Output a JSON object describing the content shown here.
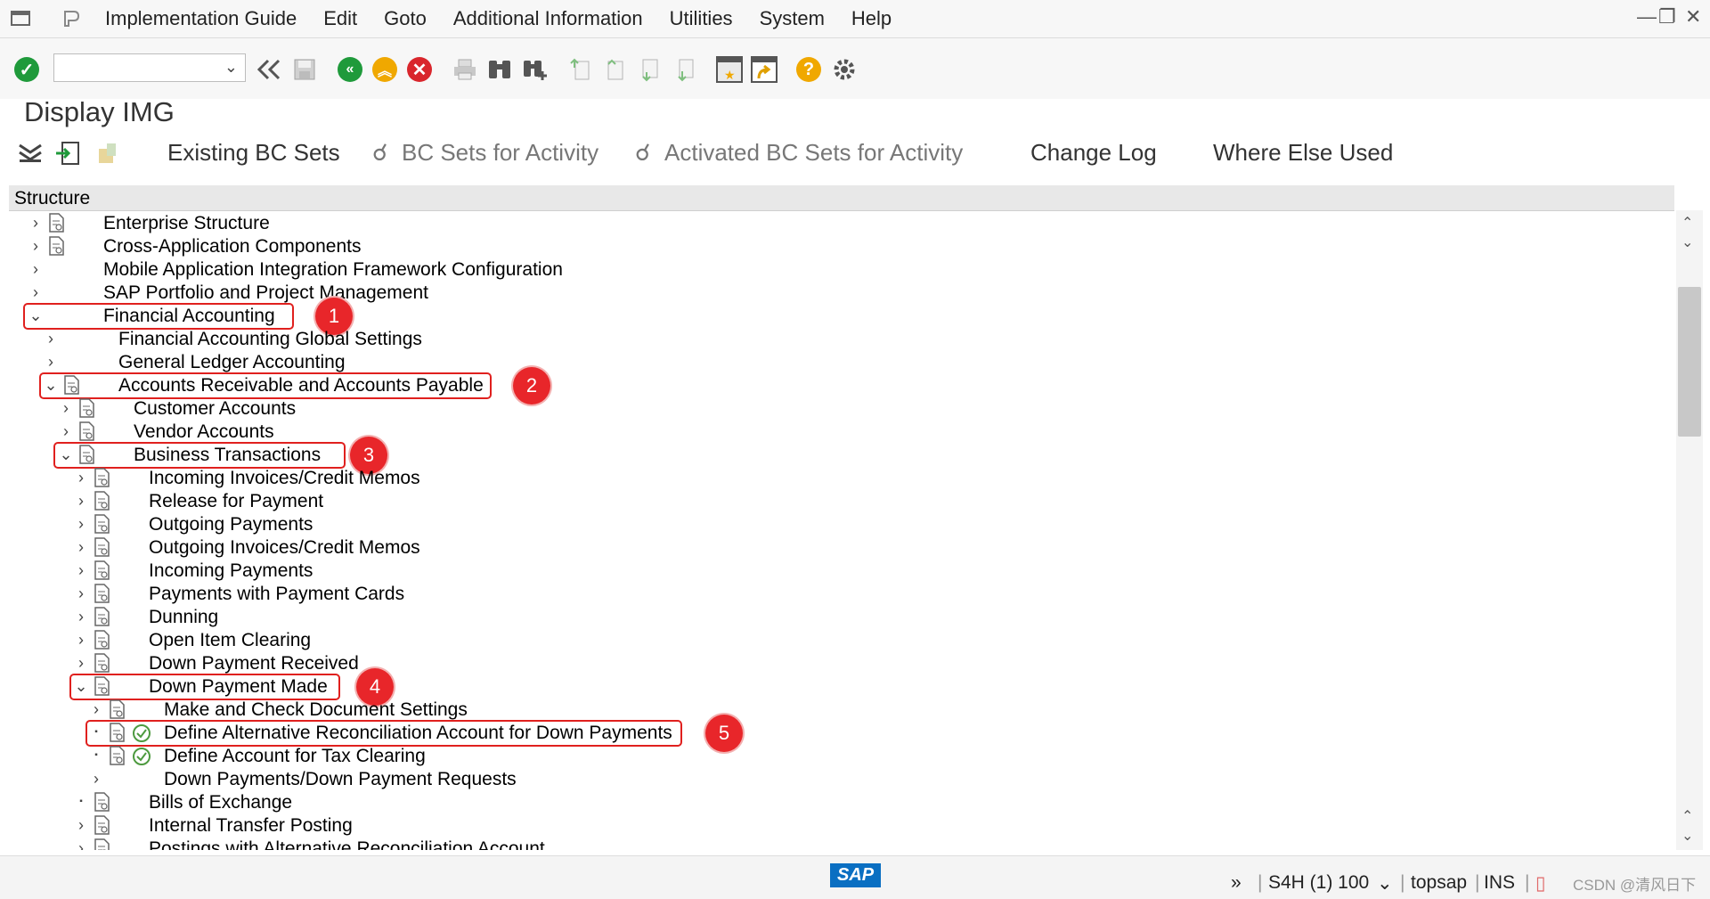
{
  "menu": {
    "items": [
      "Implementation Guide",
      "Edit",
      "Goto",
      "Additional Information",
      "Utilities",
      "System",
      "Help"
    ]
  },
  "window_controls": {
    "minimize": "—",
    "restore": "❐",
    "close": "✕"
  },
  "toolbar": {
    "command_field_value": "",
    "icons": [
      "enter-icon",
      "back-double-icon",
      "save-icon",
      "back-icon",
      "exit-icon",
      "cancel-icon",
      "print-icon",
      "find-icon",
      "find-next-icon",
      "first-page-icon",
      "previous-page-icon",
      "next-page-icon",
      "last-page-icon",
      "new-session-icon",
      "shortcut-icon",
      "help-icon",
      "settings-icon"
    ]
  },
  "page": {
    "title": "Display IMG"
  },
  "app_toolbar": {
    "existing_bc_sets": "Existing BC Sets",
    "bc_sets_for_activity": "BC Sets for Activity",
    "activated_bc_sets": "Activated BC Sets for Activity",
    "change_log": "Change Log",
    "where_else_used": "Where Else Used"
  },
  "tree": {
    "header": "Structure",
    "nodes": [
      {
        "label": "Enterprise Structure",
        "level": 0,
        "state": "collapsed",
        "doc": true
      },
      {
        "label": "Cross-Application Components",
        "level": 0,
        "state": "collapsed",
        "doc": true
      },
      {
        "label": "Mobile Application Integration Framework Configuration",
        "level": 0,
        "state": "collapsed",
        "doc": false
      },
      {
        "label": "SAP Portfolio and Project Management",
        "level": 0,
        "state": "collapsed",
        "doc": false
      },
      {
        "label": "Financial Accounting",
        "level": 0,
        "state": "expanded",
        "doc": false,
        "badge": "1"
      },
      {
        "label": "Financial Accounting Global Settings",
        "level": 1,
        "state": "collapsed",
        "doc": false
      },
      {
        "label": "General Ledger Accounting",
        "level": 1,
        "state": "collapsed",
        "doc": false
      },
      {
        "label": "Accounts Receivable and Accounts Payable",
        "level": 1,
        "state": "expanded",
        "doc": true,
        "badge": "2"
      },
      {
        "label": "Customer Accounts",
        "level": 2,
        "state": "collapsed",
        "doc": true
      },
      {
        "label": "Vendor Accounts",
        "level": 2,
        "state": "collapsed",
        "doc": true
      },
      {
        "label": "Business Transactions",
        "level": 2,
        "state": "expanded",
        "doc": true,
        "badge": "3"
      },
      {
        "label": "Incoming Invoices/Credit Memos",
        "level": 3,
        "state": "collapsed",
        "doc": true
      },
      {
        "label": "Release for Payment",
        "level": 3,
        "state": "collapsed",
        "doc": true
      },
      {
        "label": "Outgoing Payments",
        "level": 3,
        "state": "collapsed",
        "doc": true
      },
      {
        "label": "Outgoing Invoices/Credit Memos",
        "level": 3,
        "state": "collapsed",
        "doc": true
      },
      {
        "label": "Incoming Payments",
        "level": 3,
        "state": "collapsed",
        "doc": true
      },
      {
        "label": "Payments with Payment Cards",
        "level": 3,
        "state": "collapsed",
        "doc": true
      },
      {
        "label": "Dunning",
        "level": 3,
        "state": "collapsed",
        "doc": true
      },
      {
        "label": "Open Item Clearing",
        "level": 3,
        "state": "collapsed",
        "doc": true
      },
      {
        "label": "Down Payment Received",
        "level": 3,
        "state": "collapsed",
        "doc": true
      },
      {
        "label": "Down Payment Made",
        "level": 3,
        "state": "expanded",
        "doc": true,
        "badge": "4"
      },
      {
        "label": "Make and Check Document Settings",
        "level": 4,
        "state": "collapsed",
        "doc": true
      },
      {
        "label": "Define Alternative Reconciliation Account for Down Payments",
        "level": 4,
        "state": "leaf",
        "doc": true,
        "exec": true,
        "badge": "5"
      },
      {
        "label": "Define Account for Tax Clearing",
        "level": 4,
        "state": "leaf",
        "doc": true,
        "exec": true
      },
      {
        "label": "Down Payments/Down Payment Requests",
        "level": 4,
        "state": "collapsed",
        "doc": false
      },
      {
        "label": "Bills of Exchange",
        "level": 3,
        "state": "leaf",
        "doc": true
      },
      {
        "label": "Internal Transfer Posting",
        "level": 3,
        "state": "collapsed",
        "doc": true
      },
      {
        "label": "Postings with Alternative Reconciliation Account",
        "level": 3,
        "state": "collapsed",
        "doc": true
      }
    ]
  },
  "status": {
    "logo": "SAP",
    "system": "S4H (1) 100",
    "server": "topsap",
    "mode": "INS",
    "watermark": "CSDN @清风日下"
  }
}
